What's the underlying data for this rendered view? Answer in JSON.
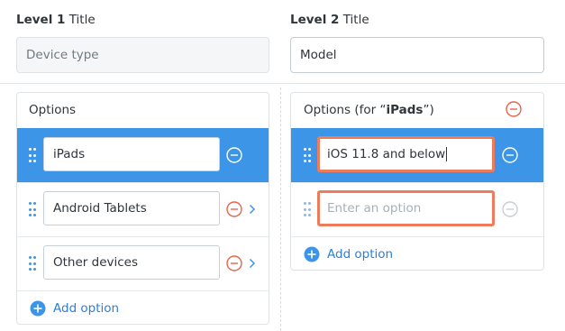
{
  "level1": {
    "label_bold": "Level 1",
    "label_rest": " Title",
    "input_value": "Device type"
  },
  "level2": {
    "label_bold": "Level 2",
    "label_rest": " Title",
    "input_value": "Model"
  },
  "panel1": {
    "header": "Options",
    "options": [
      {
        "value": "iPads",
        "selected": true
      },
      {
        "value": "Android Tablets",
        "selected": false
      },
      {
        "value": "Other devices",
        "selected": false
      }
    ],
    "add_label": "Add option"
  },
  "panel2": {
    "header_prefix": "Options (for “",
    "header_bold": "iPads",
    "header_suffix": "”)",
    "options": [
      {
        "value": "iOS 11.8 and below",
        "selected": true
      }
    ],
    "new_option_placeholder": "Enter an option",
    "add_label": "Add option"
  },
  "colors": {
    "accent_blue": "#3d95e7",
    "remove_red": "#e9634b",
    "highlight_orange": "#ef7b5a"
  },
  "icons": {
    "drag": "drag-handle-icon",
    "remove": "remove-circle-icon",
    "chevron": "chevron-right-icon",
    "add": "add-circle-icon"
  }
}
